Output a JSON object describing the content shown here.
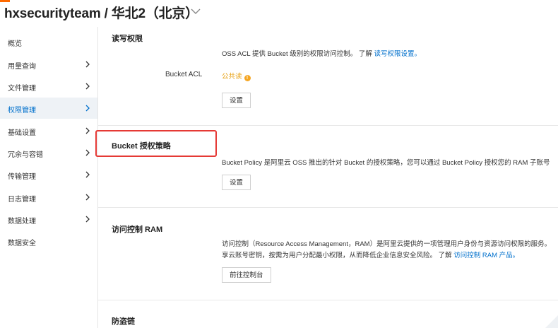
{
  "header": {
    "title": "hxsecurityteam / 华北2（北京）",
    "dropdown_icon": "chevron-down-icon"
  },
  "sidebar": {
    "items": [
      {
        "label": "概览",
        "has_arrow": false,
        "active": false
      },
      {
        "label": "用量查询",
        "has_arrow": true,
        "active": false
      },
      {
        "label": "文件管理",
        "has_arrow": true,
        "active": false
      },
      {
        "label": "权限管理",
        "has_arrow": true,
        "active": true
      },
      {
        "label": "基础设置",
        "has_arrow": true,
        "active": false
      },
      {
        "label": "冗余与容错",
        "has_arrow": true,
        "active": false
      },
      {
        "label": "传输管理",
        "has_arrow": true,
        "active": false
      },
      {
        "label": "日志管理",
        "has_arrow": true,
        "active": false
      },
      {
        "label": "数据处理",
        "has_arrow": true,
        "active": false
      },
      {
        "label": "数据安全",
        "has_arrow": false,
        "active": false
      }
    ]
  },
  "sections": {
    "acl": {
      "title": "读写权限",
      "desc_text": "OSS ACL 提供 Bucket 级别的权限访问控制。 了解 ",
      "desc_link": "读写权限设置。",
      "field_label": "Bucket ACL",
      "field_value": "公共读",
      "button": "设置"
    },
    "policy": {
      "title": "Bucket 授权策略",
      "desc_text": "Bucket Policy 是阿里云 OSS 推出的针对 Bucket 的授权策略，您可以通过 Bucket Policy 授权您的 RAM 子账号",
      "button": "设置"
    },
    "ram": {
      "title": "访问控制 RAM",
      "desc_line1": "访问控制（Resource Access Management，RAM）是阿里云提供的一项管理用户身份与资源访问权限的服务。",
      "desc_line2_text": "享云账号密钥，按需为用户分配最小权限，从而降低企业信息安全风险。 了解 ",
      "desc_link": "访问控制 RAM 产品。",
      "button": "前往控制台"
    },
    "hotlink": {
      "title": "防盗链"
    }
  },
  "colors": {
    "accent": "#0070cc",
    "warning": "#f5a623",
    "highlight_border": "#e53935",
    "brand_orange": "#ff6a00"
  }
}
